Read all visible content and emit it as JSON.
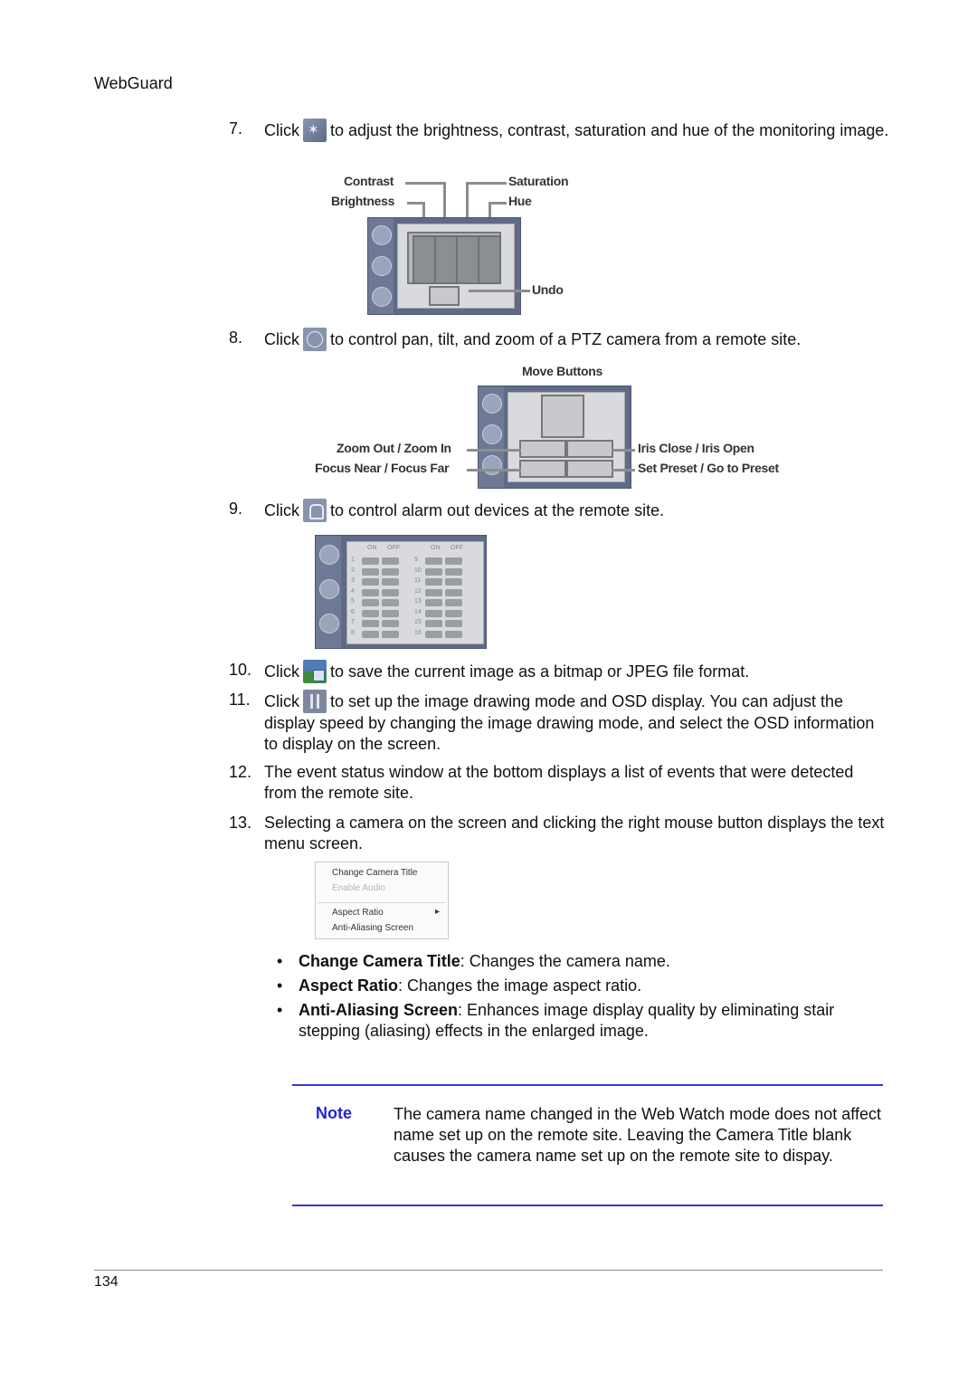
{
  "header": {
    "title": "WebGuard"
  },
  "steps": [
    {
      "num": "7.",
      "pre": "Click",
      "icon": "image-adjust-icon",
      "post": "to adjust the brightness, contrast, saturation and hue of the monitoring image."
    },
    {
      "num": "8.",
      "pre": "Click",
      "icon": "ptz-icon",
      "post": "to control pan, tilt, and zoom of a PTZ camera from a remote site."
    },
    {
      "num": "9.",
      "pre": "Click",
      "icon": "alarm-out-icon",
      "post": "to control alarm out devices at the remote site."
    },
    {
      "num": "10.",
      "pre": "Click",
      "icon": "save-image-icon",
      "post": "to save the current image as a bitmap or JPEG file format."
    },
    {
      "num": "11.",
      "pre": "Click",
      "icon": "osd-setup-icon",
      "post": "to set up the image drawing mode and OSD display. You can adjust the display speed by changing the image drawing mode, and select the OSD information to display on the screen."
    },
    {
      "num": "12.",
      "text": "The event status window at the bottom displays a list of events that were detected from the remote site."
    },
    {
      "num": "13.",
      "text": "Selecting a camera on the screen and clicking the right mouse button displays the text menu screen."
    }
  ],
  "figure_adjust": {
    "labels": {
      "contrast": "Contrast",
      "brightness": "Brightness",
      "saturation": "Saturation",
      "hue": "Hue",
      "undo": "Undo"
    }
  },
  "figure_ptz": {
    "labels": {
      "move": "Move Buttons",
      "zoom": "Zoom Out / Zoom In",
      "focus": "Focus Near / Focus Far",
      "iris": "Iris Close / Iris Open",
      "preset": "Set Preset / Go to Preset"
    }
  },
  "figure_alarm": {
    "col_headers": [
      "ON",
      "OFF",
      "ON",
      "OFF"
    ],
    "left_rows": [
      "1",
      "2",
      "3",
      "4",
      "5",
      "6",
      "7",
      "8"
    ],
    "right_rows": [
      "9",
      "10",
      "11",
      "12",
      "13",
      "14",
      "15",
      "16"
    ]
  },
  "context_menu": {
    "items": [
      {
        "label": "Change Camera Title",
        "enabled": true
      },
      {
        "label": "Enable Audio",
        "enabled": false
      },
      {
        "label": "Aspect Ratio",
        "enabled": true,
        "submenu": true
      },
      {
        "label": "Anti-Aliasing Screen",
        "enabled": true
      }
    ],
    "submenu_arrow": "▸"
  },
  "bullets": [
    {
      "term": "Change Camera Title",
      "desc": ": Changes the camera name."
    },
    {
      "term": "Aspect Ratio",
      "desc": ": Changes the image aspect ratio."
    },
    {
      "term": "Anti-Aliasing Screen",
      "desc": ": Enhances image display quality by eliminating stair stepping (aliasing) effects in the enlarged image."
    }
  ],
  "bullet_glyph": "•",
  "note": {
    "label": "Note",
    "text": "The camera name changed in the Web Watch mode does not affect name set up on the remote site. Leaving the Camera Title blank causes the camera name set up on the remote site to dispay."
  },
  "footer": {
    "page_number": "134"
  },
  "colors": {
    "note_accent": "#2026d4",
    "rule": "#3436d9"
  }
}
